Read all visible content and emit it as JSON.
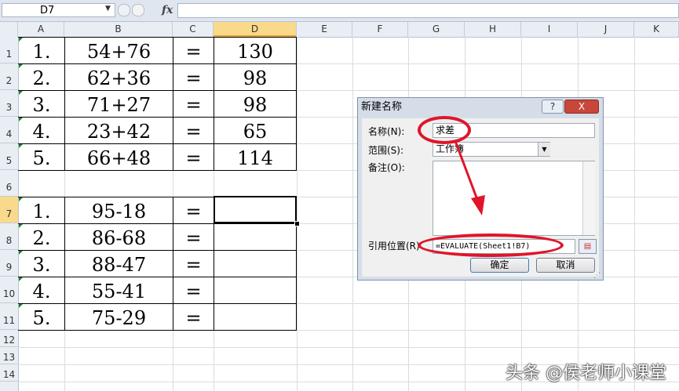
{
  "formula_bar": {
    "name_box": "D7",
    "fx": "fx",
    "formula": ""
  },
  "columns": [
    "A",
    "B",
    "C",
    "D",
    "E",
    "F",
    "G",
    "H",
    "I",
    "J",
    "K"
  ],
  "selected_column": "D",
  "rows": [
    "1",
    "2",
    "3",
    "4",
    "5",
    "6",
    "7",
    "8",
    "9",
    "10",
    "11",
    "12",
    "13",
    "14"
  ],
  "selected_row": "7",
  "table1": [
    [
      "1.",
      "54+76",
      "=",
      "130"
    ],
    [
      "2.",
      "62+36",
      "=",
      "98"
    ],
    [
      "3.",
      "71+27",
      "=",
      "98"
    ],
    [
      "4.",
      "23+42",
      "=",
      "65"
    ],
    [
      "5.",
      "66+48",
      "=",
      "114"
    ]
  ],
  "table2": [
    [
      "1.",
      "95-18",
      "=",
      ""
    ],
    [
      "2.",
      "86-68",
      "=",
      ""
    ],
    [
      "3.",
      "88-47",
      "=",
      ""
    ],
    [
      "4.",
      "55-41",
      "=",
      ""
    ],
    [
      "5.",
      "75-29",
      "=",
      ""
    ]
  ],
  "dialog": {
    "title": "新建名称",
    "help_button": "?",
    "close_button": "X",
    "name_label": "名称(N):",
    "name_value": "求差",
    "scope_label": "范围(S):",
    "scope_value": "工作簿",
    "comment_label": "备注(O):",
    "refers_label": "引用位置(R)",
    "refers_value": "=EVALUATE(Sheet1!B7)",
    "ok_button": "确定",
    "cancel_button": "取消"
  },
  "watermark": "头条 @侯老师小课堂",
  "colors": {
    "annotation": "#e0152a",
    "selected_header": "#f9d98a"
  }
}
